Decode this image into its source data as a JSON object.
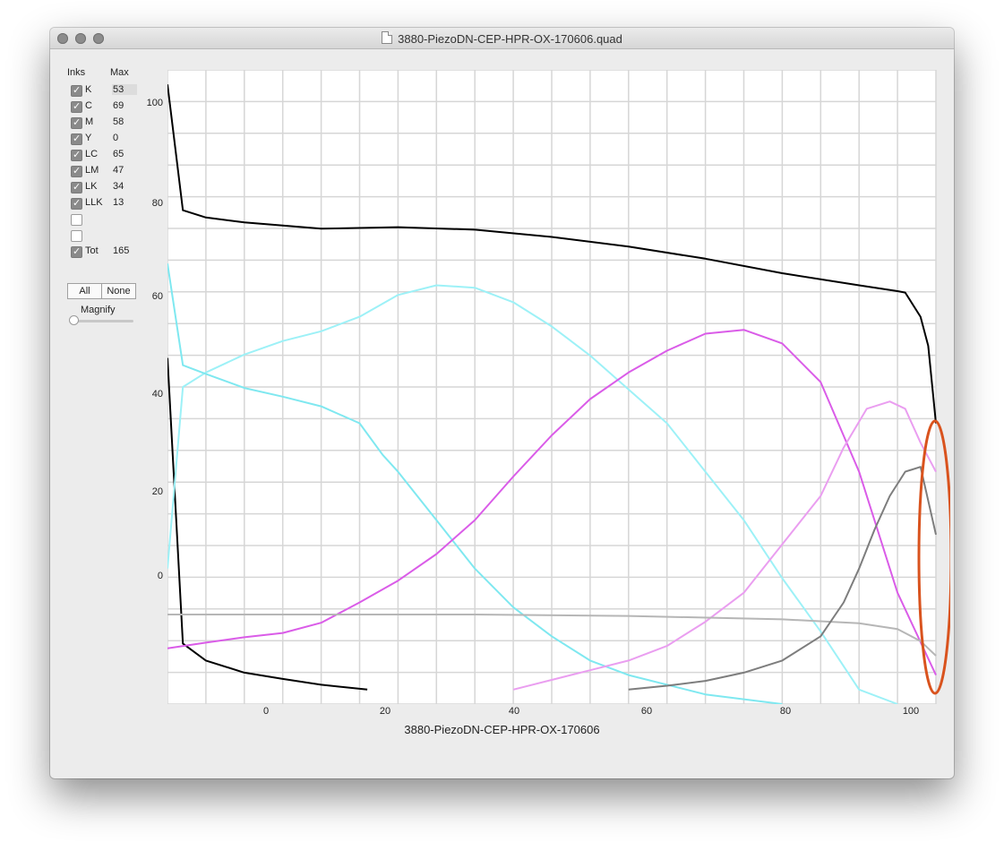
{
  "window": {
    "title": "3880-PiezoDN-CEP-HPR-OX-170606.quad"
  },
  "panel": {
    "inks_header": "Inks",
    "max_header": "Max",
    "inks": [
      {
        "name": "K",
        "max": "53",
        "checked": true
      },
      {
        "name": "C",
        "max": "69",
        "checked": true
      },
      {
        "name": "M",
        "max": "58",
        "checked": true
      },
      {
        "name": "Y",
        "max": "0",
        "checked": true
      },
      {
        "name": "LC",
        "max": "65",
        "checked": true
      },
      {
        "name": "LM",
        "max": "47",
        "checked": true
      },
      {
        "name": "LK",
        "max": "34",
        "checked": true
      },
      {
        "name": "LLK",
        "max": "13",
        "checked": true
      },
      {
        "name": "",
        "max": "",
        "checked": false
      },
      {
        "name": "",
        "max": "",
        "checked": false
      },
      {
        "name": "Tot",
        "max": "165",
        "checked": true
      }
    ],
    "all_label": "All",
    "none_label": "None",
    "magnify_label": "Magnify",
    "magnify_value": 0
  },
  "chart_data": {
    "type": "line",
    "title": "3880-PiezoDN-CEP-HPR-OX-170606",
    "y_ticks": [
      "100",
      "80",
      "60",
      "40",
      "20",
      "0"
    ],
    "x_ticks": [
      "0",
      "20",
      "40",
      "60",
      "80",
      "100"
    ],
    "annotation": {
      "shape": "ellipse",
      "color": "#d9531e",
      "label": ""
    },
    "series": [
      {
        "color": "#000000",
        "points": [
          [
            0,
            100
          ],
          [
            2,
            74
          ],
          [
            5,
            72.5
          ],
          [
            10,
            71.5
          ],
          [
            20,
            70.2
          ],
          [
            30,
            70.5
          ],
          [
            40,
            70
          ],
          [
            50,
            68.5
          ],
          [
            60,
            66.5
          ],
          [
            70,
            64
          ],
          [
            80,
            61
          ],
          [
            90,
            58.5
          ],
          [
            95,
            57.3
          ],
          [
            96,
            57
          ],
          [
            98,
            52
          ],
          [
            99,
            46
          ],
          [
            100,
            30
          ]
        ]
      },
      {
        "color": "#000000",
        "points": [
          [
            0,
            43.5
          ],
          [
            2,
            -15.5
          ],
          [
            5,
            -19
          ],
          [
            10,
            -21.5
          ],
          [
            15,
            -22.8
          ],
          [
            20,
            -24
          ],
          [
            26,
            -25
          ]
        ]
      },
      {
        "color": "#9df1f7",
        "points": [
          [
            0,
            0
          ],
          [
            2,
            37.5
          ],
          [
            5,
            40.5
          ],
          [
            10,
            44.2
          ],
          [
            15,
            47
          ],
          [
            20,
            49
          ],
          [
            25,
            52
          ],
          [
            30,
            56.5
          ],
          [
            35,
            58.5
          ],
          [
            40,
            58
          ],
          [
            45,
            55
          ],
          [
            50,
            50
          ],
          [
            55,
            44
          ],
          [
            60,
            37
          ],
          [
            65,
            30
          ],
          [
            70,
            20
          ],
          [
            75,
            10
          ],
          [
            80,
            -2
          ],
          [
            85,
            -13
          ],
          [
            90,
            -25
          ],
          [
            95,
            -28
          ]
        ]
      },
      {
        "color": "#7fe8f0",
        "points": [
          [
            0,
            63
          ],
          [
            2,
            42
          ],
          [
            5,
            40.2
          ],
          [
            10,
            37.3
          ],
          [
            15,
            35.5
          ],
          [
            20,
            33.5
          ],
          [
            25,
            30
          ],
          [
            28,
            23.5
          ],
          [
            30,
            20
          ],
          [
            35,
            10
          ],
          [
            40,
            0
          ],
          [
            45,
            -8
          ],
          [
            50,
            -14
          ],
          [
            55,
            -19
          ],
          [
            60,
            -22
          ],
          [
            65,
            -24
          ],
          [
            70,
            -26
          ],
          [
            80,
            -28
          ]
        ]
      },
      {
        "color": "#da5ce8",
        "points": [
          [
            0,
            -16.5
          ],
          [
            5,
            -15.3
          ],
          [
            10,
            -14.2
          ],
          [
            15,
            -13.3
          ],
          [
            20,
            -11.2
          ],
          [
            25,
            -7
          ],
          [
            30,
            -2.5
          ],
          [
            35,
            3
          ],
          [
            40,
            10
          ],
          [
            45,
            19
          ],
          [
            50,
            27.5
          ],
          [
            55,
            35
          ],
          [
            60,
            40.5
          ],
          [
            65,
            45
          ],
          [
            70,
            48.5
          ],
          [
            75,
            49.3
          ],
          [
            80,
            46.5
          ],
          [
            85,
            38.5
          ],
          [
            90,
            20
          ],
          [
            95,
            -5
          ],
          [
            100,
            -22
          ]
        ]
      },
      {
        "color": "#ea9ef0",
        "points": [
          [
            45,
            -25
          ],
          [
            50,
            -23
          ],
          [
            55,
            -21
          ],
          [
            60,
            -19
          ],
          [
            65,
            -16
          ],
          [
            70,
            -11
          ],
          [
            75,
            -5
          ],
          [
            80,
            5
          ],
          [
            85,
            15
          ],
          [
            88,
            25
          ],
          [
            91,
            33
          ],
          [
            94,
            34.5
          ],
          [
            96,
            33
          ],
          [
            98,
            26
          ],
          [
            100,
            20
          ]
        ]
      },
      {
        "color": "#b6b6b6",
        "points": [
          [
            0,
            -9.5
          ],
          [
            20,
            -9.5
          ],
          [
            40,
            -9.5
          ],
          [
            60,
            -9.8
          ],
          [
            80,
            -10.5
          ],
          [
            90,
            -11.3
          ],
          [
            95,
            -12.5
          ],
          [
            98,
            -15
          ],
          [
            100,
            -18
          ]
        ]
      },
      {
        "color": "#7d7d7d",
        "points": [
          [
            60,
            -25
          ],
          [
            65,
            -24.2
          ],
          [
            70,
            -23.2
          ],
          [
            75,
            -21.5
          ],
          [
            80,
            -19
          ],
          [
            85,
            -14
          ],
          [
            88,
            -7
          ],
          [
            90,
            0
          ],
          [
            92,
            8
          ],
          [
            94,
            15
          ],
          [
            96,
            20
          ],
          [
            98,
            21
          ],
          [
            100,
            7
          ]
        ]
      }
    ]
  }
}
